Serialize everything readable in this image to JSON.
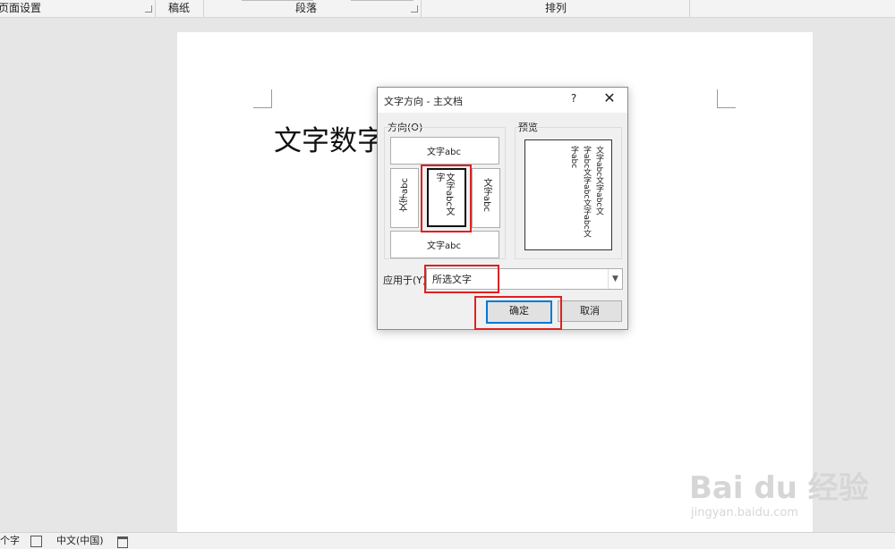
{
  "ribbon": {
    "groups": [
      "页面设置",
      "稿纸",
      "段落",
      "排列"
    ]
  },
  "document": {
    "text": "文字数字"
  },
  "dialog": {
    "title": "文字方向 - 主文档",
    "help": "?",
    "close": "✕",
    "orientation_label": "方向(O)",
    "preview_label": "预览",
    "options": {
      "horizontal": "文字abc",
      "vertical_left": "文字abc",
      "vertical_selected": "文字abc文字",
      "vertical_right": "文字abc",
      "horizontal_rotated": "文字abc"
    },
    "preview_lines": [
      "文字abc文字abc文",
      "字abc文字abc文字abc文",
      "字abc"
    ],
    "apply_label": "应用于(Y):",
    "apply_value": "所选文字",
    "ok": "确定",
    "cancel": "取消"
  },
  "statusbar": {
    "word_count": "个字",
    "language": "中文(中国)"
  },
  "watermark": {
    "brand": "Bai du 经验",
    "url": "jingyan.baidu.com"
  }
}
